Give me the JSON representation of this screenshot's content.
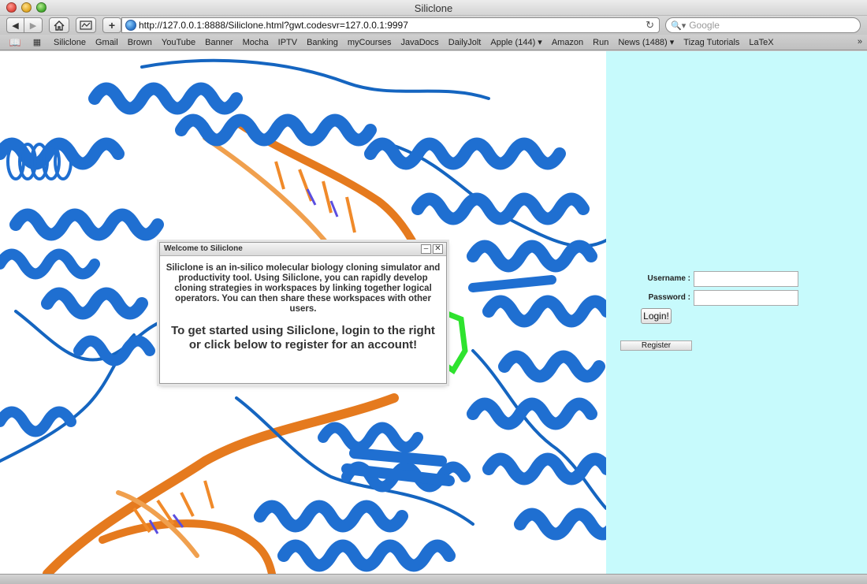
{
  "window": {
    "title": "Siliclone"
  },
  "toolbar": {
    "back_icon": "back-arrow-icon",
    "forward_icon": "forward-arrow-icon",
    "home_icon": "home-icon",
    "bookmarks_icon": "show-bookmarks-icon",
    "add_label": "+",
    "url": "http://127.0.0.1:8888/Siliclone.html?gwt.codesvr=127.0.0.1:9997",
    "search_placeholder": "Google"
  },
  "bookmarks": {
    "items": [
      "Siliclone",
      "Gmail",
      "Brown",
      "YouTube",
      "Banner",
      "Mocha",
      "IPTV",
      "Banking",
      "myCourses",
      "JavaDocs",
      "DailyJolt",
      "Apple (144) ▾",
      "Amazon",
      "Run",
      "News (1488) ▾",
      "Tizag Tutorials",
      "LaTeX"
    ],
    "overflow": "»"
  },
  "dialog": {
    "title": "Welcome to Siliclone",
    "minimize": "–",
    "close": "✕",
    "intro": "Siliclone is an in-silico molecular biology cloning simulator and productivity tool. Using Siliclone, you can rapidly develop cloning strategies in workspaces by linking together logical operators. You can then share these workspaces with other users.",
    "cta": "To get started using Siliclone, login to the right or click below to register for an account!"
  },
  "login": {
    "username_label": "Username :",
    "password_label": "Password :",
    "username_value": "",
    "password_value": "",
    "login_button": "Login!",
    "register_button": "Register"
  },
  "colors": {
    "protein": "#1f6fd1",
    "dna": "#e57a1e",
    "ligand": "#2ee32e",
    "side_panel": "#c7fafc"
  }
}
